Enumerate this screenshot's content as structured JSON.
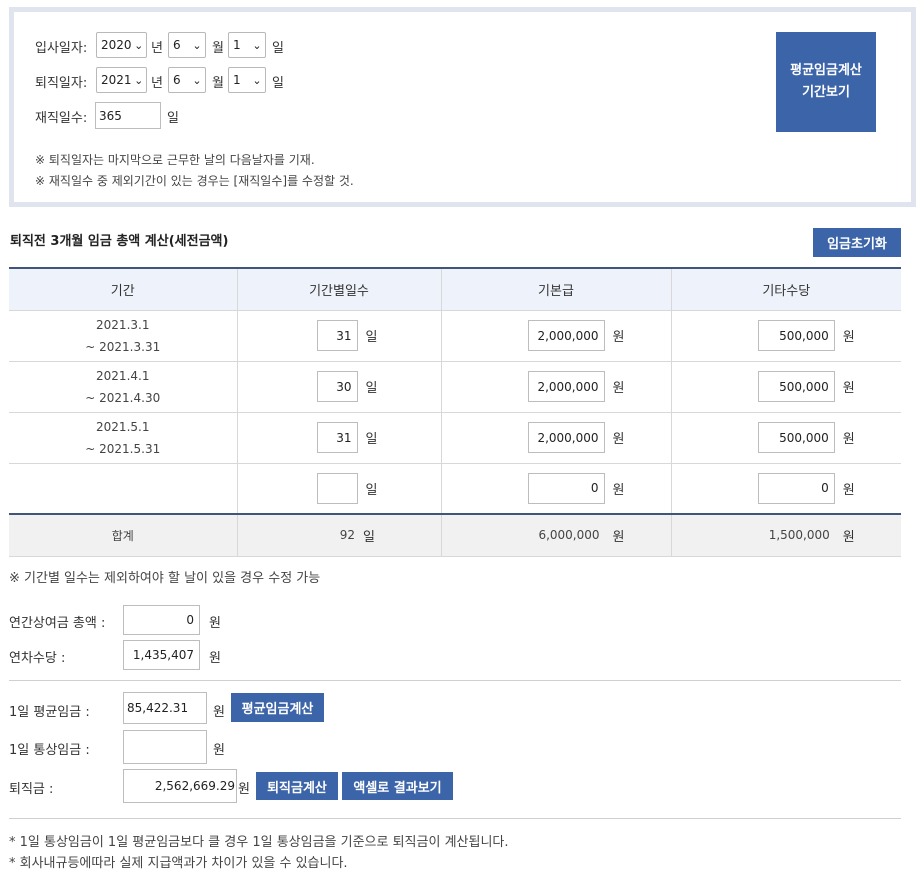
{
  "period": {
    "hire_label": "입사일자:",
    "hire_year": "2020",
    "hire_month": "6",
    "hire_day": "1",
    "leave_label": "퇴직일자:",
    "leave_year": "2021",
    "leave_month": "6",
    "leave_day": "1",
    "unit_year": "년",
    "unit_month": "월",
    "unit_day": "일",
    "tenure_label": "재직일수:",
    "tenure_value": "365",
    "tenure_unit": "일",
    "calc_button_line1": "평균임금계산",
    "calc_button_line2": "기간보기",
    "note1": "※ 퇴직일자는 마지막으로 근무한 날의 다음날자를 기재.",
    "note2": "※ 재직일수 중 제외기간이 있는 경우는 [재직일수]를 수정할 것."
  },
  "wage_section": {
    "title": "퇴직전 3개월 임금 총액 계산(세전금액)",
    "reset_button": "임금초기화"
  },
  "table": {
    "headers": [
      "기간",
      "기간별일수",
      "기본급",
      "기타수당"
    ],
    "rows": [
      {
        "start": "2021.3.1",
        "end": "~ 2021.3.31",
        "days": "31",
        "base": "2,000,000",
        "other": "500,000"
      },
      {
        "start": "2021.4.1",
        "end": "~ 2021.4.30",
        "days": "30",
        "base": "2,000,000",
        "other": "500,000"
      },
      {
        "start": "2021.5.1",
        "end": "~ 2021.5.31",
        "days": "31",
        "base": "2,000,000",
        "other": "500,000"
      },
      {
        "start": "",
        "end": "",
        "days": "",
        "base": "0",
        "other": "0"
      }
    ],
    "unit_day": "일",
    "unit_won": "원",
    "sum_label": "합계",
    "sum_days": "92",
    "sum_base": "6,000,000",
    "sum_other": "1,500,000"
  },
  "table_note": "※ 기간별 일수는 제외하여야 할 날이 있을 경우 수정 가능",
  "extras": {
    "bonus_label": "연간상여금 총액 :",
    "bonus_value": "0",
    "leave_allow_label": "연차수당 :",
    "leave_allow_value": "1,435,407",
    "unit_won": "원"
  },
  "results": {
    "avg_label": "1일 평균임금 :",
    "avg_value": "85,422.31",
    "avg_button": "평균임금계산",
    "ordinary_label": "1일 통상임금 :",
    "ordinary_value": "",
    "severance_label": "퇴직금 :",
    "severance_value": "2,562,669.29",
    "severance_button": "퇴직금계산",
    "excel_button": "액셀로 결과보기",
    "unit_won": "원"
  },
  "footnotes": {
    "line1": "* 1일 통상임금이 1일 평균임금보다 클 경우 1일 통상임금을 기준으로 퇴직금이 계산됩니다.",
    "line2": "* 회사내규등에따라 실제 지급액과가 차이가 있을 수 있습니다."
  }
}
